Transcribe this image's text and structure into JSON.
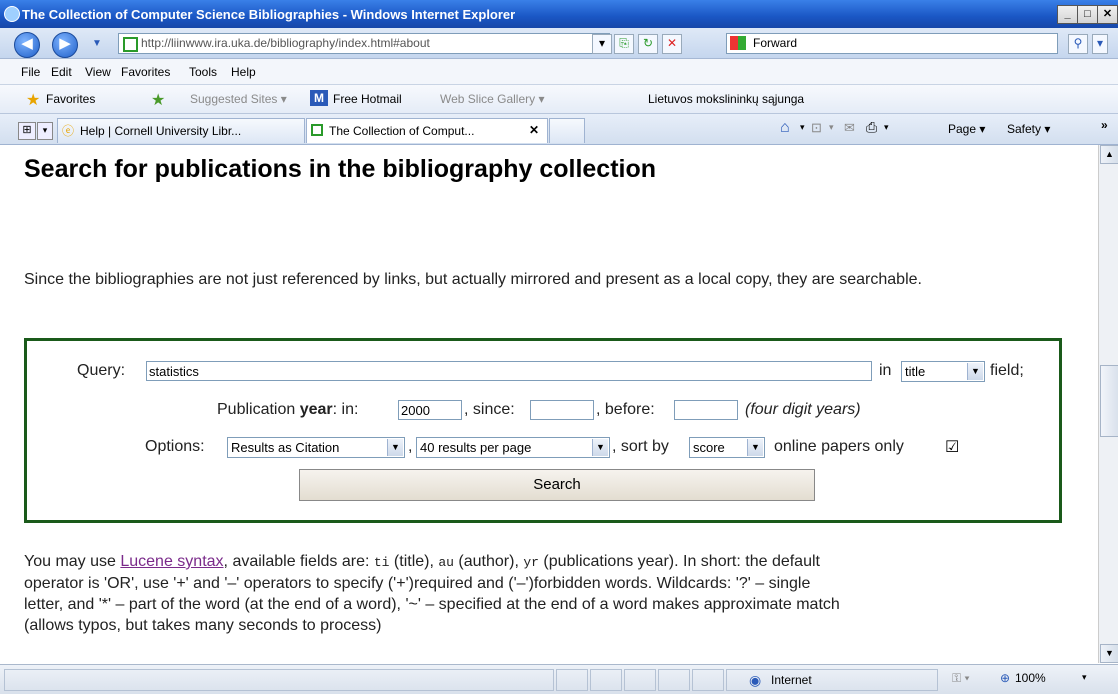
{
  "window": {
    "title": "The Collection of Computer Science Bibliographies - Windows Internet Explorer"
  },
  "address": {
    "url": "http://liinwww.ira.uka.de/bibliography/index.html#about"
  },
  "search_box": {
    "text": "Forward"
  },
  "menu": [
    "File",
    "Edit",
    "View",
    "Favorites",
    "Tools",
    "Help"
  ],
  "favorites_bar": {
    "favorites_label": "Favorites",
    "items": [
      "Suggested Sites ▾",
      "Free Hotmail",
      "Web Slice Gallery ▾",
      "Lietuvos mokslininkų sąjunga"
    ]
  },
  "tabs": [
    {
      "label": "Help | Cornell University Libr..."
    },
    {
      "label": "The Collection of Comput..."
    }
  ],
  "command_bar": {
    "page": "Page ▾",
    "safety": "Safety ▾"
  },
  "page": {
    "heading": "Search for publications in the bibliography collection",
    "intro": "Since the bibliographies are not just referenced by links, but actually mirrored and present as a local copy, they are searchable.",
    "form": {
      "query_label": "Query:",
      "query_value": "statistics",
      "in_label": "in",
      "field_select": "title",
      "field_suffix": "field;",
      "year_label_pre": "Publication ",
      "year_label_bold": "year",
      "year_label_post": ": in:",
      "year_in": "2000",
      "since_label": ", since:",
      "since_value": "",
      "before_label": ", before:",
      "before_value": "",
      "year_hint": "(four digit years)",
      "options_label": "Options:",
      "results_select": "Results as Citation",
      "per_page_select": "40 results per page",
      "sort_label": ", sort by",
      "sort_select": "score",
      "online_label": "online papers only",
      "online_checked": "☑",
      "comma": ",",
      "search_button": "Search"
    },
    "help": {
      "pre": "You may use ",
      "link": "Lucene syntax",
      "line1_rest": ", available fields are: ",
      "f_ti": "ti",
      "t_ti": " (title), ",
      "f_au": "au",
      "t_au": " (author), ",
      "f_yr": "yr",
      "t_yr": " (publications year). In short: the default",
      "line2": "operator is 'OR', use '+' and '–' operators to specify ('+')required and ('–')forbidden words. Wildcards: '?' – single",
      "line3": "letter, and '*' – part of the word (at the end of a word), '~' – specified at the end of a word makes approximate match",
      "line4": "(allows typos, but takes many seconds to process)"
    }
  },
  "status_bar": {
    "zone": "Internet",
    "zoom": "100%"
  }
}
